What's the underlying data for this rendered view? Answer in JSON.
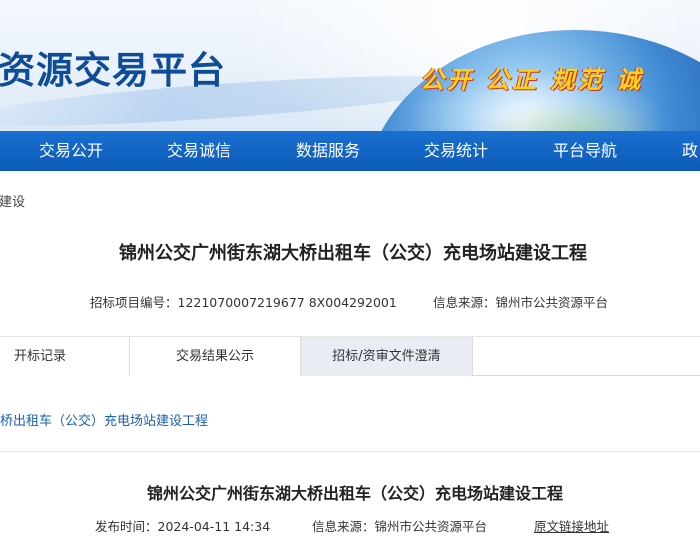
{
  "header": {
    "site_title": "资源交易平台",
    "slogan": "公开 公正 规范 诚"
  },
  "nav": {
    "items": [
      {
        "label": "交易公开"
      },
      {
        "label": "交易诚信"
      },
      {
        "label": "数据服务"
      },
      {
        "label": "交易统计"
      },
      {
        "label": "平台导航"
      },
      {
        "label": "政"
      }
    ]
  },
  "breadcrumb": "建设",
  "project": {
    "title": "锦州公交广州街东湖大桥出租车（公交）充电场站建设工程",
    "code_text": "招标项目编号：1221070007219677 8X004292001",
    "source_text": "信息来源：锦州市公共资源平台"
  },
  "tabs": [
    {
      "label": "开标记录"
    },
    {
      "label": "交易结果公示"
    },
    {
      "label": "招标/资审文件澄清"
    }
  ],
  "sub_link": "桥出租车（公交）充电场站建设工程",
  "article": {
    "title": "锦州公交广州街东湖大桥出租车（公交）充电场站建设工程",
    "publish_time": "发布时间：2024-04-11 14:34",
    "source": "信息来源：锦州市公共资源平台",
    "original_link": "原文链接地址"
  }
}
